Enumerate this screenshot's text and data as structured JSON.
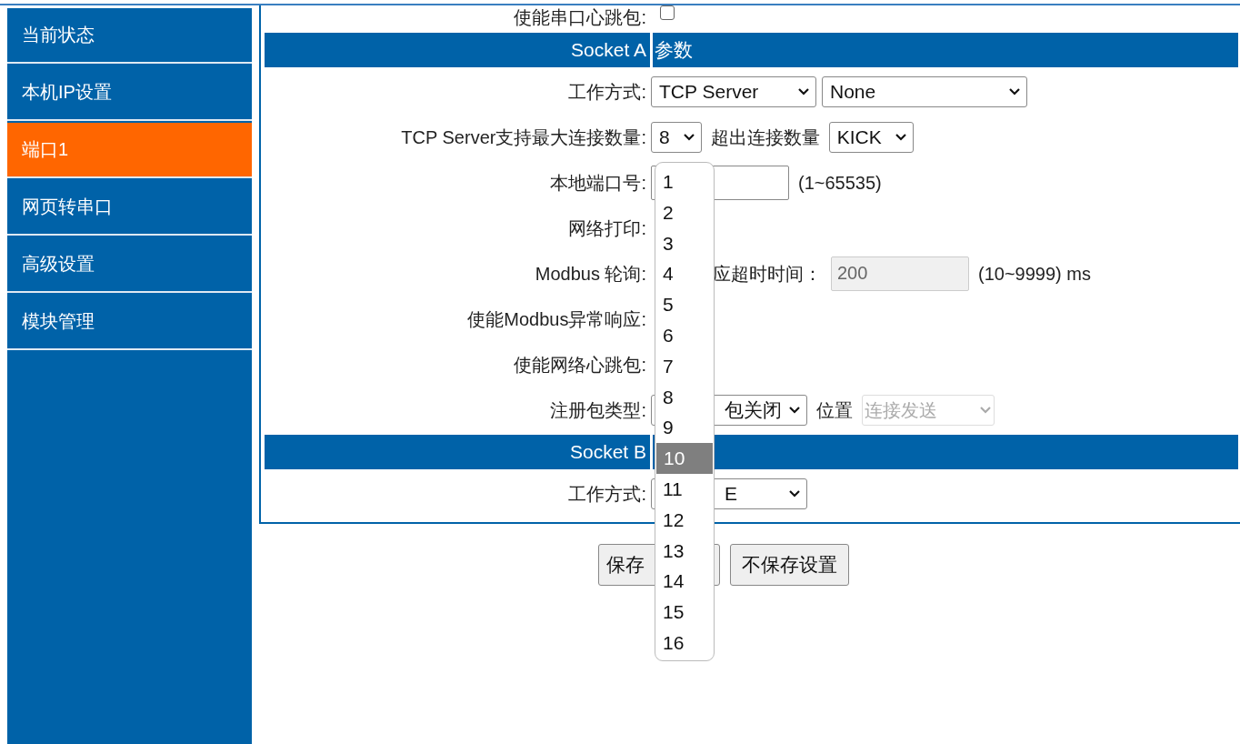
{
  "sidebar": {
    "items": [
      {
        "label": "当前状态",
        "selected": false
      },
      {
        "label": "本机IP设置",
        "selected": false
      },
      {
        "label": "端口1",
        "selected": true
      },
      {
        "label": "网页转串口",
        "selected": false
      },
      {
        "label": "高级设置",
        "selected": false
      },
      {
        "label": "模块管理",
        "selected": false
      }
    ]
  },
  "form": {
    "rows": [
      {
        "kind": "row",
        "label": "使能串口心跳包:",
        "controls": [
          {
            "kind": "checkbox",
            "checked": false
          }
        ]
      },
      {
        "kind": "header",
        "title": "Socket A",
        "subtitle": "参数"
      },
      {
        "kind": "row",
        "label": "工作方式:",
        "controls": [
          {
            "kind": "select",
            "value": "TCP Server"
          },
          {
            "kind": "select",
            "value": "None"
          }
        ]
      },
      {
        "kind": "row",
        "label": "TCP Server支持最大连接数量:",
        "controls": [
          {
            "kind": "select",
            "value": "8"
          },
          {
            "kind": "text",
            "text": "超出连接数量"
          },
          {
            "kind": "select",
            "value": "KICK"
          }
        ]
      },
      {
        "kind": "row",
        "label": "本地端口号:",
        "controls": [
          {
            "kind": "input"
          },
          {
            "kind": "text",
            "text": "(1~65535)"
          }
        ]
      },
      {
        "kind": "row",
        "label": "网络打印:",
        "controls": []
      },
      {
        "kind": "row",
        "label": "Modbus 轮询:",
        "controls": [
          {
            "kind": "clipped-text",
            "text": "应超时时间："
          },
          {
            "kind": "input",
            "value": "200",
            "disabled": true
          },
          {
            "kind": "text",
            "text": "(10~9999) ms"
          }
        ]
      },
      {
        "kind": "row",
        "label": "使能Modbus异常响应:",
        "controls": []
      },
      {
        "kind": "row",
        "label": "使能网络心跳包:",
        "controls": []
      },
      {
        "kind": "row",
        "label": "注册包类型:",
        "controls": [
          {
            "kind": "clipped-select",
            "value": "包关闭"
          },
          {
            "kind": "text",
            "text": "位置"
          },
          {
            "kind": "select",
            "value": "连接发送",
            "disabled": true
          }
        ]
      },
      {
        "kind": "header",
        "title": "Socket B"
      },
      {
        "kind": "row",
        "label": "工作方式:",
        "controls": [
          {
            "kind": "clipped-select",
            "value": "E"
          }
        ]
      }
    ]
  },
  "buttons": [
    "保存",
    "不保存设置"
  ],
  "dropdown": {
    "options": [
      {
        "label": "1",
        "selected": false
      },
      {
        "label": "2",
        "selected": false
      },
      {
        "label": "3",
        "selected": false
      },
      {
        "label": "4",
        "selected": false
      },
      {
        "label": "5",
        "selected": false
      },
      {
        "label": "6",
        "selected": false
      },
      {
        "label": "7",
        "selected": false
      },
      {
        "label": "8",
        "selected": false
      },
      {
        "label": "9",
        "selected": false
      },
      {
        "label": "10",
        "selected": true
      },
      {
        "label": "11",
        "selected": false
      },
      {
        "label": "12",
        "selected": false
      },
      {
        "label": "13",
        "selected": false
      },
      {
        "label": "14",
        "selected": false
      },
      {
        "label": "15",
        "selected": false
      },
      {
        "label": "16",
        "selected": false
      }
    ]
  }
}
